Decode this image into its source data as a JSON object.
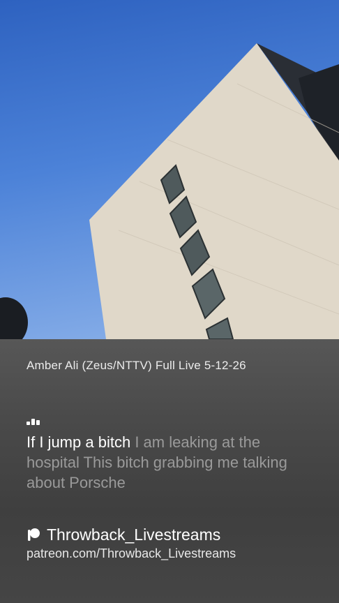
{
  "video": {
    "scene": "building-against-sky"
  },
  "stream": {
    "title": "Amber Ali (Zeus/NTTV) Full Live 5-12-26"
  },
  "lyrics": {
    "current_line": "If I jump a bitch",
    "upcoming_text": "I am leaking at the hospital This bitch grabbing me talking about Porsche"
  },
  "credit": {
    "icon": "patreon-icon",
    "name": "Throwback_Livestreams",
    "url": "patreon.com/Throwback_Livestreams"
  },
  "colors": {
    "sky": "#4c82d8",
    "building": "#e0d8c9",
    "panel": "#4a4a4a",
    "text_active": "#ffffff",
    "text_dim": "#9a9a9a"
  }
}
